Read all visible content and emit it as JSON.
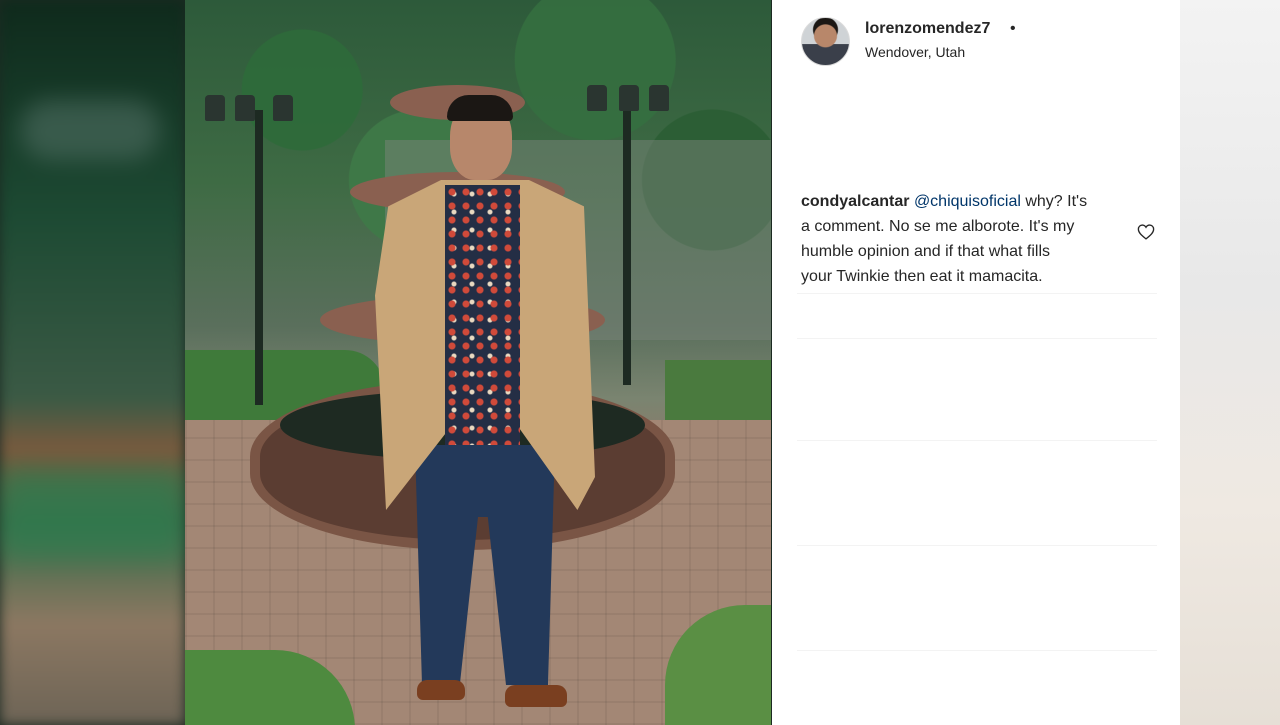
{
  "post": {
    "username": "lorenzomendez7",
    "separator": "•",
    "location": "Wendover, Utah"
  },
  "comment": {
    "username": "condyalcantar",
    "mention": "@chiquisoficial",
    "text_line1_rest": " why? It's",
    "text_line2": "a comment. No se me alborote. It's my",
    "text_line3": "humble opinion and if that what fills",
    "text_line4": "your Twinkie then eat it mamacita."
  },
  "icons": {
    "like": "heart-icon",
    "avatar": "avatar"
  },
  "colors": {
    "text": "#262626",
    "mention": "#003569",
    "panel_bg": "#ffffff"
  }
}
